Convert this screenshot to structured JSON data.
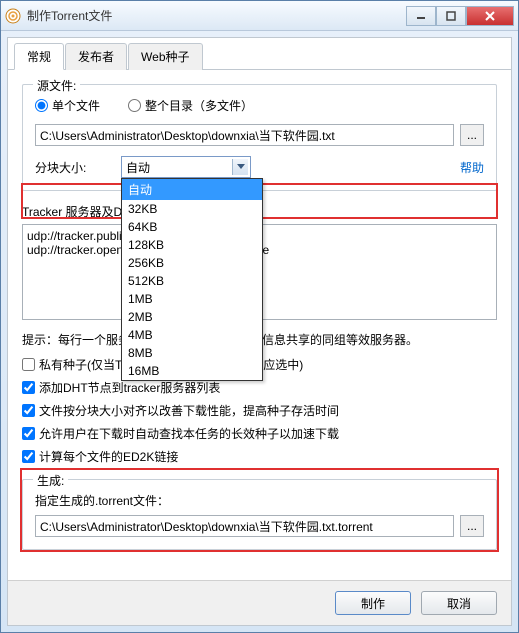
{
  "window": {
    "title": "制作Torrent文件"
  },
  "tabs": [
    {
      "label": "常规",
      "active": true
    },
    {
      "label": "发布者",
      "active": false
    },
    {
      "label": "Web种子",
      "active": false
    }
  ],
  "source": {
    "legend": "源文件:",
    "radio_single": "单个文件",
    "radio_dir": "整个目录（多文件）",
    "radio_selected": "single",
    "path": "C:\\Users\\Administrator\\Desktop\\downxia\\当下软件园.txt"
  },
  "piece": {
    "label": "分块大小:",
    "value": "自动",
    "options": [
      "自动",
      "32KB",
      "64KB",
      "128KB",
      "256KB",
      "512KB",
      "1MB",
      "2MB",
      "4MB",
      "8MB",
      "16MB"
    ],
    "open": true,
    "highlight_index": 0
  },
  "help_label": "帮助",
  "trackers": {
    "label": "Tracker 服务器及DHT节点列表:",
    "text": "udp://tracker.publicbt.com:80/announce\nudp://tracker.openbittorrent.com:80/announce"
  },
  "hint": "提示：每行一个服务器地址。至少填写一个是信息共享的同组等效服务器。",
  "checks": [
    {
      "checked": false,
      "label": "私有种子(仅当Tracker服务器要求使用时才应选中)"
    },
    {
      "checked": true,
      "label": "添加DHT节点到tracker服务器列表"
    },
    {
      "checked": true,
      "label": "文件按分块大小对齐以改善下载性能，提高种子存活时间"
    },
    {
      "checked": true,
      "label": "允许用户在下载时自动查找本任务的长效种子以加速下载"
    },
    {
      "checked": true,
      "label": "计算每个文件的ED2K链接"
    }
  ],
  "output": {
    "legend": "生成:",
    "label": "指定生成的.torrent文件：",
    "path": "C:\\Users\\Administrator\\Desktop\\downxia\\当下软件园.txt.torrent"
  },
  "buttons": {
    "ok": "制作",
    "cancel": "取消"
  },
  "browse_glyph": "..."
}
